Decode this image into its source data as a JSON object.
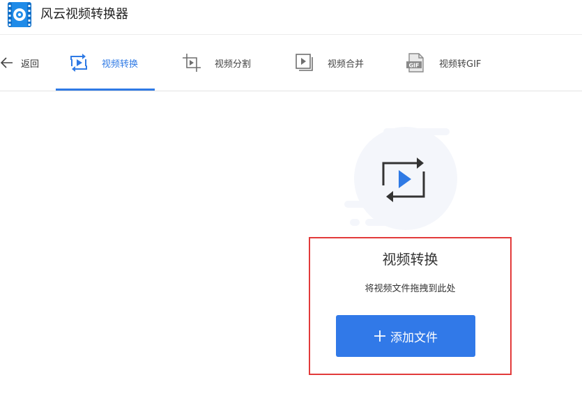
{
  "app": {
    "title": "风云视频转换器",
    "brand_color": "#2f7ae5"
  },
  "nav": {
    "back_label": "返回",
    "tabs": [
      {
        "label": "视频转换",
        "icon": "video-convert-icon",
        "active": true
      },
      {
        "label": "视频分割",
        "icon": "video-split-icon",
        "active": false
      },
      {
        "label": "视频合并",
        "icon": "video-merge-icon",
        "active": false
      },
      {
        "label": "视频转GIF",
        "icon": "video-gif-icon",
        "active": false
      }
    ],
    "gif_badge": "GIF"
  },
  "main": {
    "title": "视频转换",
    "subtitle": "将视频文件拖拽到此处",
    "add_button_label": "添加文件",
    "add_button_icon": "plus-icon",
    "highlight_color": "#e23a3a"
  }
}
